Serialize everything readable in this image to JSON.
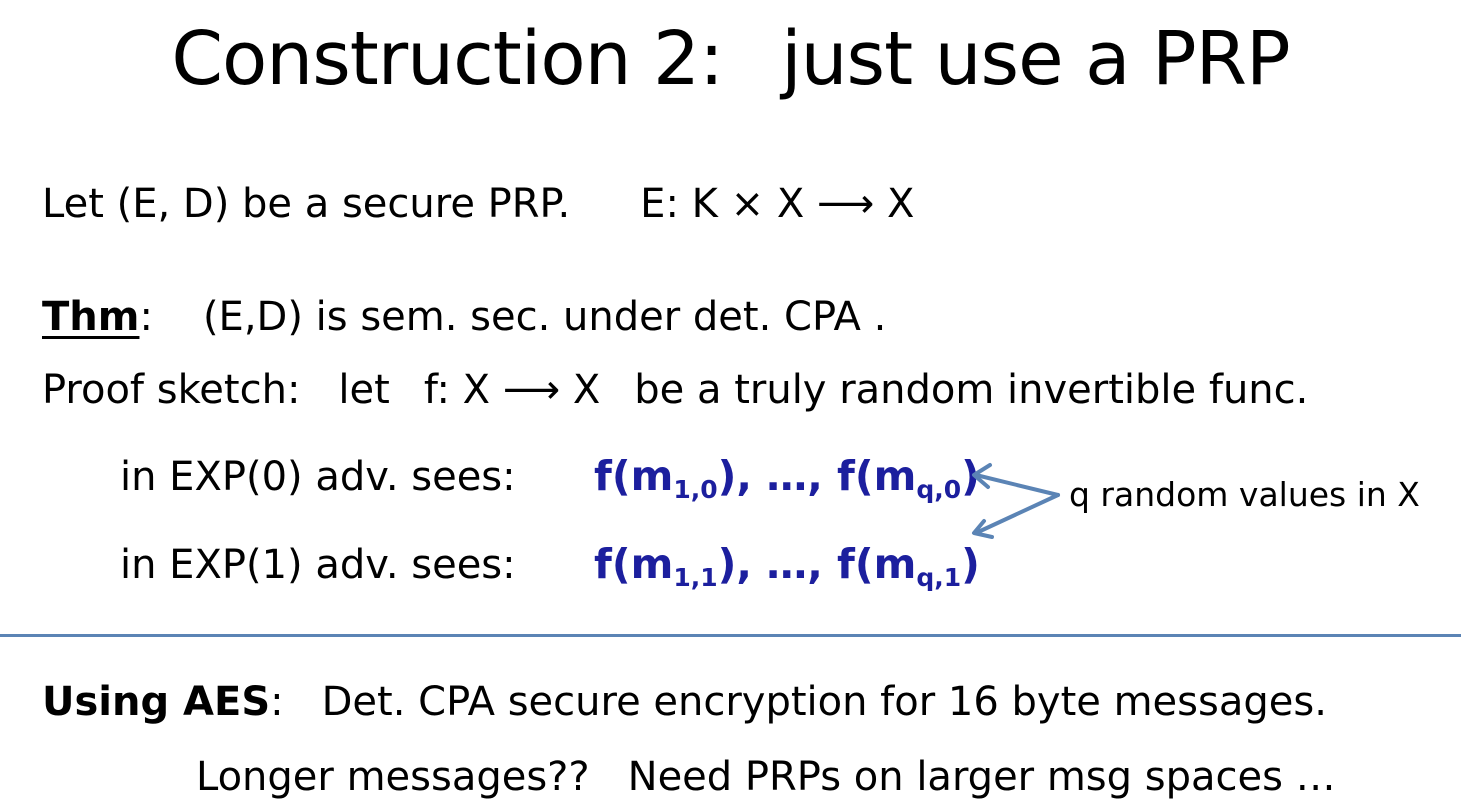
{
  "title": {
    "left": "Construction 2:",
    "right": "just use a PRP"
  },
  "line1": {
    "left": "Let  (E, D) be a secure PRP.",
    "right": "E: K × X ⟶ X"
  },
  "thm": {
    "label": "Thm",
    "colon": ":",
    "text": "(E,D) is sem. sec. under det. CPA ."
  },
  "proof": {
    "label": "Proof sketch:",
    "let": "let",
    "func": "f: X ⟶ X",
    "rest": "be a truly random invertible func."
  },
  "exp0": {
    "label": "in  EXP(0)  adv. sees:",
    "f1_open": "f(m",
    "s1": "1,0",
    "mid": "), …, f(m",
    "s2": "q,0",
    "close": ")"
  },
  "exp1": {
    "label": "in  EXP(1)  adv. sees:",
    "f1_open": "f(m",
    "s1": "1,1",
    "mid": "), …, f(m",
    "s2": "q,1",
    "close": ")"
  },
  "note": "q random values in X",
  "aes": {
    "label": "Using AES",
    "colon": ":",
    "text": "Det. CPA secure encryption for 16 byte messages."
  },
  "longer": {
    "left": "Longer messages??",
    "right": "Need PRPs on larger msg spaces …"
  },
  "colors": {
    "math": "#1c1f9e",
    "arrow": "#5b84b5",
    "divider": "#5b84b5"
  }
}
